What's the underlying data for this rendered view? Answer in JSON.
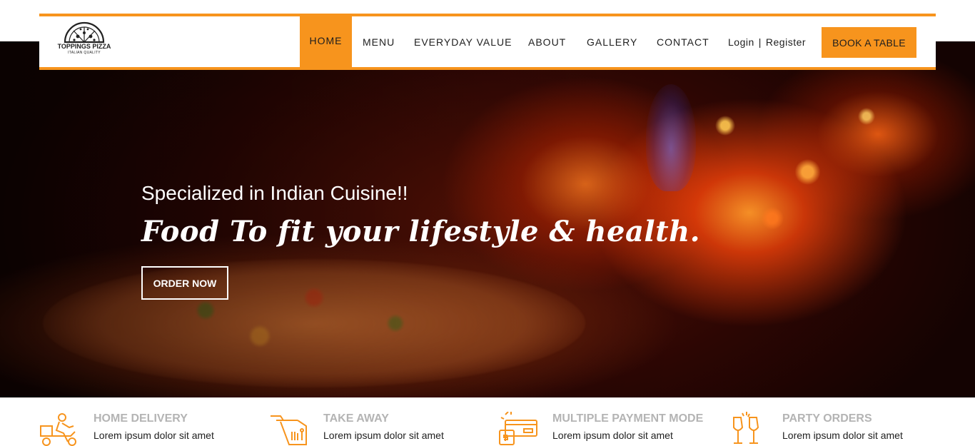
{
  "brand": {
    "name": "TOPPINGS PIZZA",
    "tagline": "ITALIAN QUALITY"
  },
  "nav": {
    "items": [
      {
        "label": "HOME",
        "active": true
      },
      {
        "label": "MENU"
      },
      {
        "label": "EVERYDAY VALUE"
      },
      {
        "label": "ABOUT"
      },
      {
        "label": "GALLERY"
      },
      {
        "label": "CONTACT"
      }
    ],
    "login_label": "Login",
    "separator": "|",
    "register_label": "Register",
    "book_label": "BOOK A TABLE"
  },
  "hero": {
    "subtitle": "Specialized in Indian Cuisine!!",
    "title": "Food To fit your lifestyle & health.",
    "cta_label": "ORDER NOW"
  },
  "features": [
    {
      "icon": "delivery-scooter-icon",
      "title": "HOME DELIVERY",
      "desc": "Lorem ipsum dolor sit amet"
    },
    {
      "icon": "takeaway-bag-icon",
      "title": "TAKE AWAY",
      "desc": "Lorem ipsum dolor sit amet"
    },
    {
      "icon": "payment-card-icon",
      "title": "MULTIPLE PAYMENT MODE",
      "desc": "Lorem ipsum dolor sit amet"
    },
    {
      "icon": "champagne-glasses-icon",
      "title": "PARTY ORDERS",
      "desc": "Lorem ipsum dolor sit amet"
    }
  ],
  "colors": {
    "accent": "#f7941d",
    "text_dark": "#1e1e1e",
    "feature_title": "#b4b4b4",
    "white": "#ffffff"
  }
}
